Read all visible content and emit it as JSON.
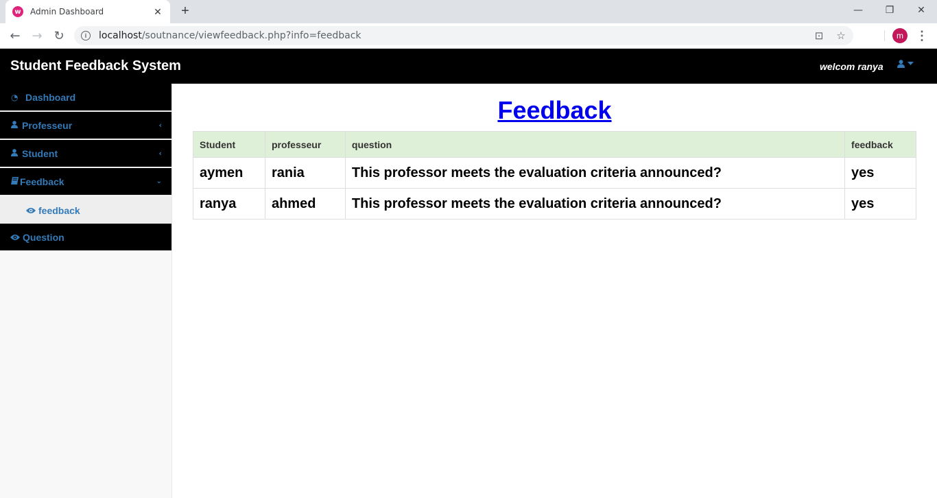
{
  "browser": {
    "tab_title": "Admin Dashboard",
    "tab_favicon": "w",
    "url_host": "localhost",
    "url_path": "/soutnance/viewfeedback.php?info=feedback",
    "profile_initial": "m"
  },
  "header": {
    "brand": "Student Feedback System",
    "welcome": "welcom ranya"
  },
  "sidebar": {
    "items": [
      {
        "label": "Dashboard",
        "icon": "dashboard-icon"
      },
      {
        "label": "Professeur",
        "icon": "user-icon"
      },
      {
        "label": "Student",
        "icon": "user-icon"
      },
      {
        "label": "Feedback",
        "icon": "book-icon"
      },
      {
        "label": "Question",
        "icon": "eye-icon"
      }
    ],
    "subitem": {
      "label": "feedback",
      "icon": "eye-icon"
    }
  },
  "main": {
    "title": "Feedback",
    "table": {
      "headers": [
        "Student",
        "professeur",
        "question",
        "feedback"
      ],
      "rows": [
        [
          "aymen",
          "rania",
          "This professor meets the evaluation criteria announced?",
          "yes"
        ],
        [
          "ranya",
          "ahmed",
          "This professor meets the evaluation criteria announced?",
          "yes"
        ]
      ]
    }
  },
  "colors": {
    "accent_blue": "#337ab7",
    "header_bg": "#000000",
    "table_header_bg": "#dff0d8"
  }
}
